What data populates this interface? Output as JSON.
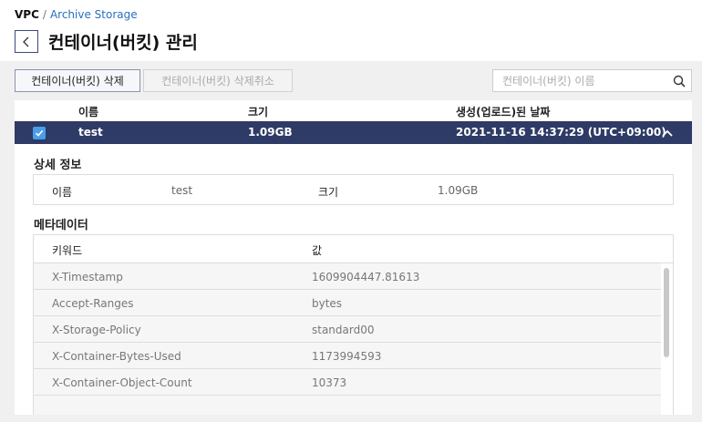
{
  "breadcrumb": {
    "root": "VPC",
    "separator": "/",
    "current": "Archive Storage"
  },
  "page": {
    "title": "컨테이너(버킷) 관리"
  },
  "toolbar": {
    "delete_label": "컨테이너(버킷) 삭제",
    "undo_delete_label": "컨테이너(버킷) 삭제취소",
    "search_placeholder": "컨테이너(버킷) 이름"
  },
  "grid": {
    "columns": {
      "name": "이름",
      "size": "크기",
      "created": "생성(업로드)된 날짜"
    },
    "rows": [
      {
        "selected": true,
        "name": "test",
        "size": "1.09GB",
        "created": "2021-11-16 14:37:29 (UTC+09:00)"
      }
    ]
  },
  "details": {
    "title": "상세 정보",
    "name_label": "이름",
    "name_value": "test",
    "size_label": "크기",
    "size_value": "1.09GB"
  },
  "metadata": {
    "title": "메타데이터",
    "key_header": "키워드",
    "value_header": "값",
    "rows": [
      {
        "key": "X-Timestamp",
        "value": "1609904447.81613"
      },
      {
        "key": "Accept-Ranges",
        "value": "bytes"
      },
      {
        "key": "X-Storage-Policy",
        "value": "standard00"
      },
      {
        "key": "X-Container-Bytes-Used",
        "value": "1173994593"
      },
      {
        "key": "X-Container-Object-Count",
        "value": "10373"
      }
    ]
  },
  "colors": {
    "selected_row": "#2e3b66",
    "link": "#2a6ebb",
    "checkbox": "#4a9ee8"
  }
}
